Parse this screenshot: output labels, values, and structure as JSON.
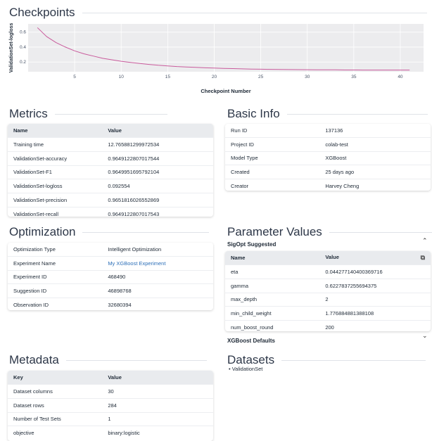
{
  "checkpoints": {
    "title": "Checkpoints",
    "chart_data": {
      "type": "line",
      "ylabel": "ValidationSet-logloss",
      "xlabel": "Checkpoint Number",
      "xlim": [
        0,
        42.5
      ],
      "ylim": [
        0.07,
        0.71
      ],
      "xticks": [
        5,
        10,
        15,
        20,
        25,
        30,
        35,
        40
      ],
      "yticks": [
        0.2,
        0.4,
        0.6
      ],
      "grid": true,
      "series": [
        {
          "x": [
            1,
            2,
            3,
            4,
            5,
            6,
            7,
            8,
            9,
            10,
            11,
            12,
            13,
            14,
            15,
            16,
            17,
            18,
            19,
            20,
            21,
            22,
            23,
            24,
            25,
            26,
            27,
            28,
            29,
            30,
            31,
            32,
            33,
            34,
            35,
            36,
            37,
            38,
            39,
            40,
            41
          ],
          "y": [
            0.66,
            0.54,
            0.46,
            0.4,
            0.35,
            0.31,
            0.28,
            0.25,
            0.23,
            0.21,
            0.195,
            0.18,
            0.168,
            0.157,
            0.148,
            0.14,
            0.134,
            0.128,
            0.123,
            0.119,
            0.115,
            0.112,
            0.109,
            0.106,
            0.104,
            0.102,
            0.1,
            0.099,
            0.098,
            0.097,
            0.096,
            0.095,
            0.095,
            0.094,
            0.094,
            0.093,
            0.093,
            0.093,
            0.093,
            0.093,
            0.093
          ]
        }
      ],
      "line_color": "#c95b9c"
    }
  },
  "metrics": {
    "title": "Metrics",
    "headers": [
      "Name",
      "Value"
    ],
    "rows": [
      [
        "Training time",
        "12.765881299972534"
      ],
      [
        "ValidationSet-accuracy",
        "0.9649122807017544"
      ],
      [
        "ValidationSet-F1",
        "0.9649951695792104"
      ],
      [
        "ValidationSet-logloss",
        "0.092554"
      ],
      [
        "ValidationSet-precision",
        "0.9651816026552869"
      ],
      [
        "ValidationSet-recall",
        "0.9649122807017543"
      ]
    ]
  },
  "basic_info": {
    "title": "Basic Info",
    "rows": [
      [
        "Run ID",
        "137136"
      ],
      [
        "Project ID",
        "colab-test"
      ],
      [
        "Model Type",
        "XGBoost"
      ],
      [
        "Created",
        "25 days ago"
      ],
      [
        "Creator",
        "Harvey Cheng"
      ]
    ]
  },
  "optimization": {
    "title": "Optimization",
    "rows": [
      [
        "Optimization Type",
        "Intelligent Optimization"
      ],
      [
        "Experiment Name",
        "My XGBoost Experiment"
      ],
      [
        "Experiment ID",
        "468490"
      ],
      [
        "Suggestion ID",
        "46898768"
      ],
      [
        "Observation ID",
        "32680394"
      ]
    ]
  },
  "parameters": {
    "title": "Parameter Values",
    "suggested_label": "SigOpt Suggested",
    "headers": [
      "Name",
      "Value"
    ],
    "rows": [
      [
        "eta",
        "0.04427714040036971​6"
      ],
      [
        "gamma",
        "0.6227837255694375"
      ],
      [
        "max_depth",
        "2"
      ],
      [
        "min_child_weight",
        "1.776884881388108"
      ],
      [
        "num_boost_round",
        "200"
      ]
    ],
    "defaults_label": "XGBoost Defaults"
  },
  "metadata": {
    "title": "Metadata",
    "headers": [
      "Key",
      "Value"
    ],
    "rows": [
      [
        "Dataset columns",
        "30"
      ],
      [
        "Dataset rows",
        "284"
      ],
      [
        "Number of Test Sets",
        "1"
      ],
      [
        "objective",
        "binary:logistic"
      ]
    ]
  },
  "datasets": {
    "title": "Datasets",
    "items": [
      "ValidationSet"
    ]
  }
}
